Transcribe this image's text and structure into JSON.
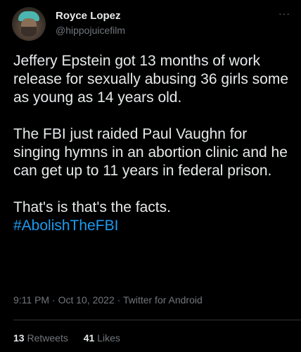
{
  "user": {
    "display_name": "Royce Lopez",
    "handle": "@hippojuicefilm"
  },
  "more_menu_glyph": "···",
  "tweet": {
    "paragraphs": [
      "Jeffery Epstein got 13 months of work release for sexually abusing 36 girls some as young as 14 years old.",
      "The FBI just raided Paul Vaughn for singing hymns in an abortion clinic and he can get up to 11 years in federal prison.",
      "That's is that's the facts."
    ],
    "hashtag": "#AbolishTheFBI"
  },
  "meta": {
    "time": "9:11 PM",
    "separator": " · ",
    "date": "Oct 10, 2022",
    "source": "Twitter for Android"
  },
  "stats": {
    "retweets_count": "13",
    "retweets_label": "Retweets",
    "likes_count": "41",
    "likes_label": "Likes"
  },
  "colors": {
    "background": "#000000",
    "text_primary": "#e7e9ea",
    "text_secondary": "#71767b",
    "link": "#1d9bf0",
    "divider": "#2f3336"
  },
  "icons": {
    "more": "more-horizontal-icon",
    "avatar": "profile-avatar"
  }
}
